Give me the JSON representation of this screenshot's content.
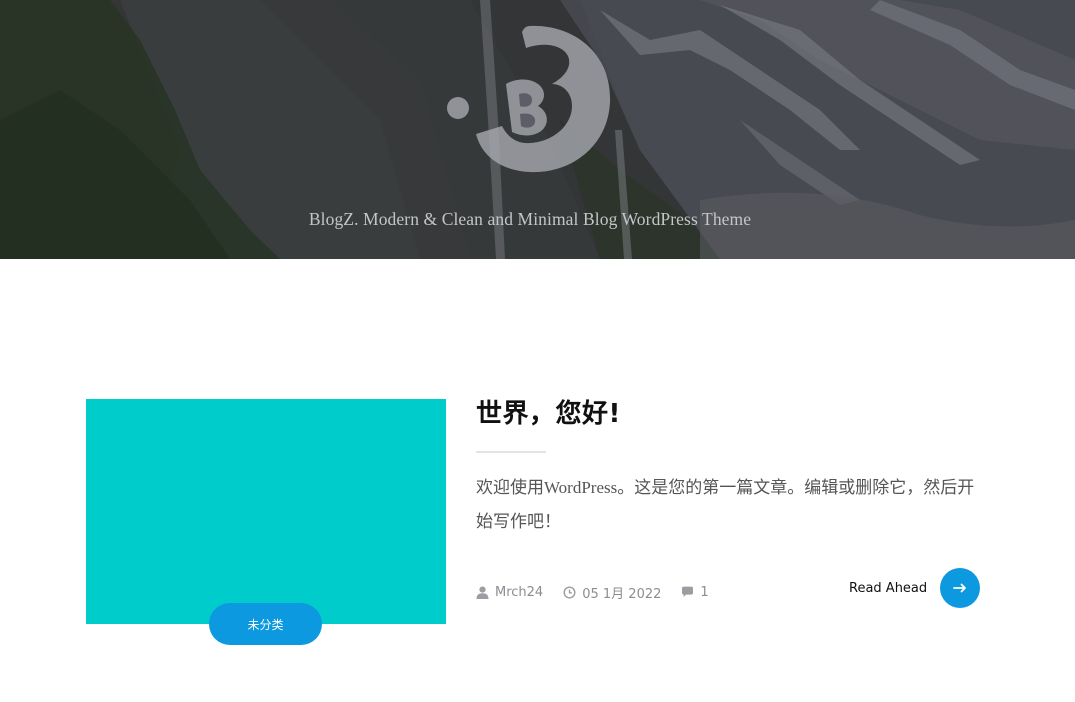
{
  "hero": {
    "tagline": "BlogZ. Modern & Clean and Minimal Blog WordPress Theme",
    "logo_icon": "blogz-b-logo"
  },
  "post": {
    "title": "世界，您好!",
    "excerpt": "欢迎使用WordPress。这是您的第一篇文章。编辑或删除它，然后开始写作吧！",
    "category": "未分类",
    "thumbnail_color": "#00cccc",
    "meta": {
      "author": "Mrch24",
      "date": "05 1月 2022",
      "comments": "1",
      "author_icon": "user-icon",
      "date_icon": "clock-icon",
      "comments_icon": "comment-icon"
    },
    "read_more_label": "Read Ahead",
    "read_more_icon": "arrow-right-icon"
  },
  "colors": {
    "accent": "#0d99e0",
    "thumbnail": "#00cccc",
    "title": "#111111",
    "text": "#555555",
    "meta": "#8a8d92"
  }
}
